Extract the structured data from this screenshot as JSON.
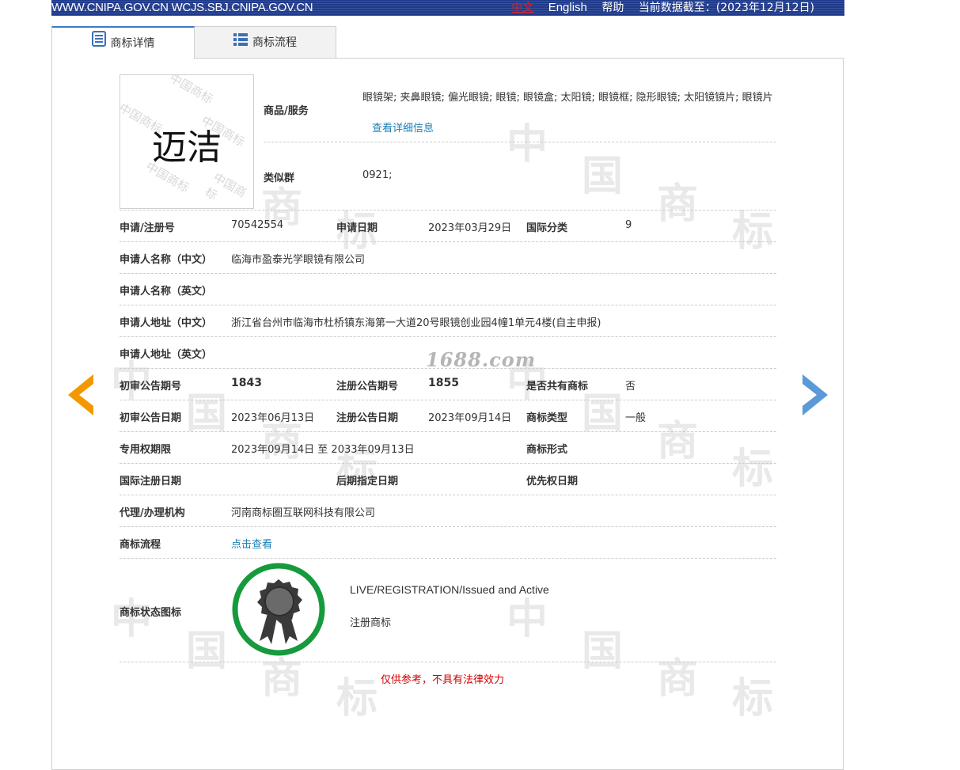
{
  "topbar": {
    "site": "WWW.CNIPA.GOV.CN WCJS.SBJ.CNIPA.GOV.CN",
    "lang_cn": "中文",
    "lang_en": "English",
    "help": "帮助",
    "data_date": "当前数据截至：(2023年12月12日)"
  },
  "tabs": {
    "detail": "商标详情",
    "flow": "商标流程"
  },
  "logo": {
    "mark_text": "迈洁",
    "wm_text": "中国商标"
  },
  "goods": {
    "label": "商品/服务",
    "text": "眼镜架; 夹鼻眼镜; 偏光眼镜; 眼镜; 眼镜盒; 太阳镜; 眼镜框; 隐形眼镜; 太阳镜镜片; 眼镜片",
    "more_link": "查看详细信息"
  },
  "similar_group": {
    "label": "类似群",
    "value": "0921;"
  },
  "fields": {
    "reg_no_label": "申请/注册号",
    "reg_no": "70542554",
    "app_date_label": "申请日期",
    "app_date": "2023年03月29日",
    "intl_class_label": "国际分类",
    "intl_class": "9",
    "applicant_cn_label": "申请人名称（中文）",
    "applicant_cn": "临海市盈泰光学眼镜有限公司",
    "applicant_en_label": "申请人名称（英文）",
    "applicant_en": "",
    "address_cn_label": "申请人地址（中文）",
    "address_cn": "浙江省台州市临海市杜桥镇东海第一大道20号眼镜创业园4幢1单元4楼(自主申报)",
    "address_en_label": "申请人地址（英文）",
    "address_en": "",
    "prelim_issue_label": "初审公告期号",
    "prelim_issue": "1843",
    "reg_issue_label": "注册公告期号",
    "reg_issue": "1855",
    "shared_label": "是否共有商标",
    "shared": "否",
    "prelim_date_label": "初审公告日期",
    "prelim_date": "2023年06月13日",
    "reg_date_label": "注册公告日期",
    "reg_date": "2023年09月14日",
    "type_label": "商标类型",
    "type": "一般",
    "term_label": "专用权期限",
    "term": "2023年09月14日 至 2033年09月13日",
    "form_label": "商标形式",
    "form": "",
    "intl_reg_date_label": "国际注册日期",
    "intl_reg_date": "",
    "later_date_label": "后期指定日期",
    "later_date": "",
    "priority_label": "优先权日期",
    "priority": "",
    "agent_label": "代理/办理机构",
    "agent": "河南商标圈互联网科技有限公司",
    "flow_label": "商标流程",
    "flow_link": "点击查看",
    "status_label": "商标状态图标",
    "status_en": "LIVE/REGISTRATION/Issued and Active",
    "status_cn": "注册商标"
  },
  "watermark_site": "1688.com",
  "watermark_chars": [
    "中",
    "国",
    "商",
    "标"
  ],
  "disclaimer": "仅供参考，不具有法律效力",
  "colors": {
    "topbar": "#1e3a8c",
    "tab_accent": "#3d7ac8",
    "link": "#1a7fb5",
    "arrow_left": "#f39800",
    "arrow_right": "#5b9ad8",
    "badge_ring": "#159a3c",
    "disclaimer": "#d40000"
  }
}
